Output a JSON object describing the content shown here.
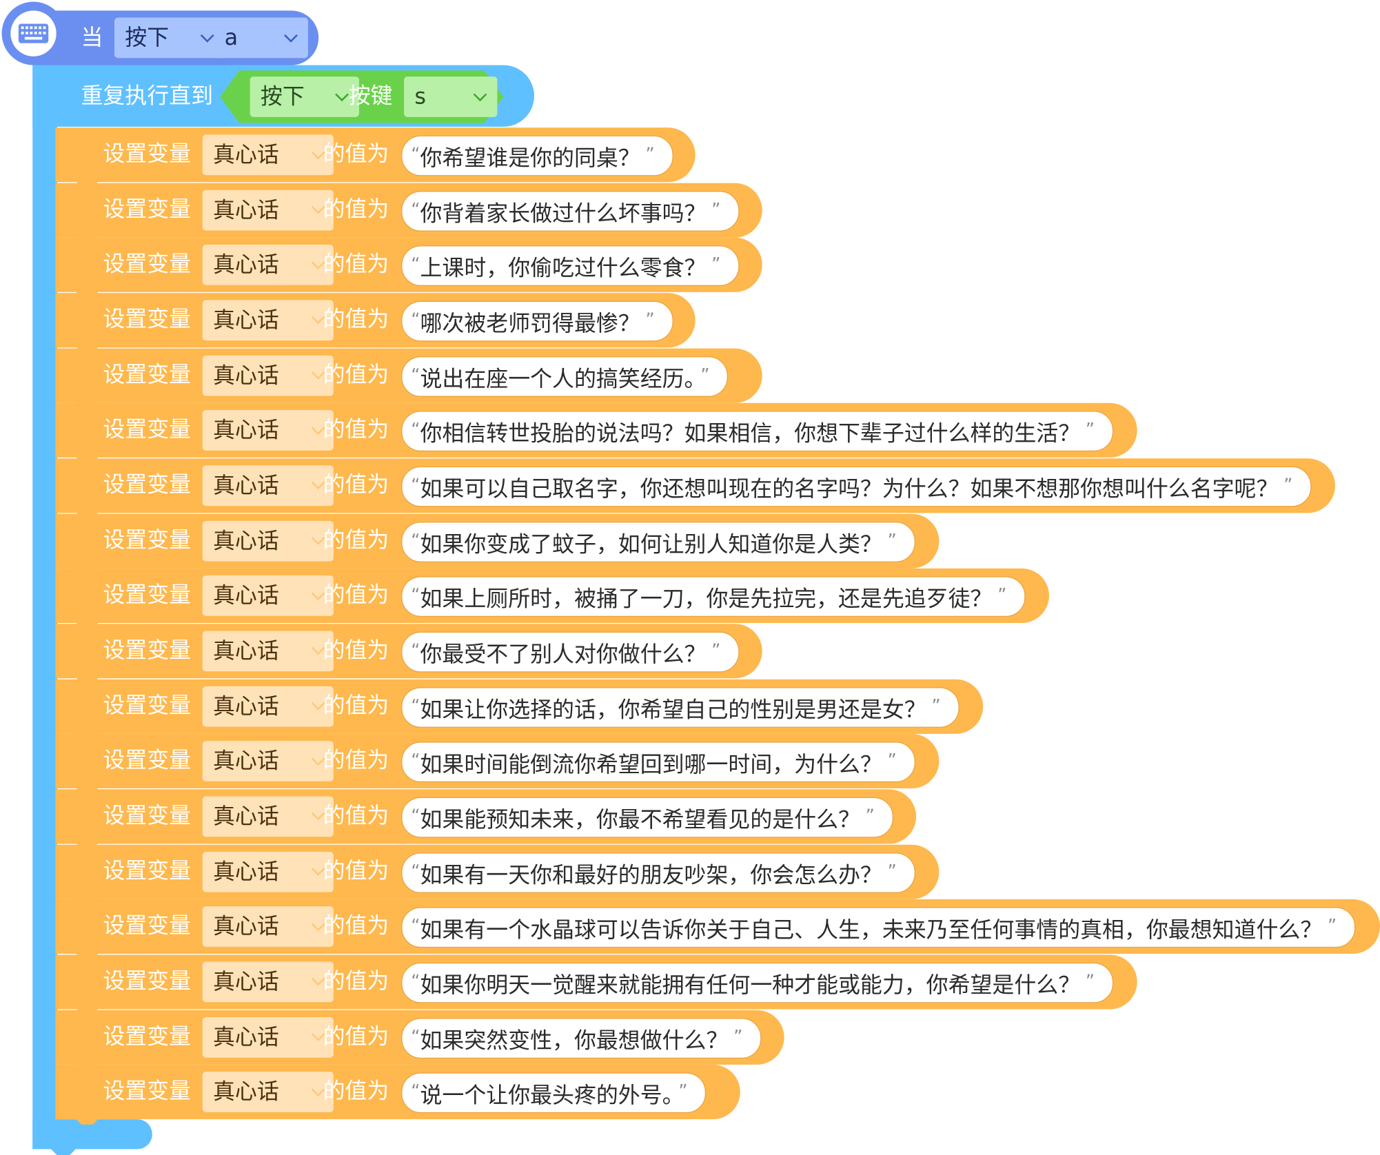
{
  "event_block": {
    "icon": "keyboard-icon",
    "when_label": "当",
    "action_dropdown": "按下",
    "key_dropdown": "a"
  },
  "loop_block": {
    "label": "重复执行直到",
    "condition": {
      "action_dropdown": "按下",
      "key_label": "按键",
      "key_dropdown": "s"
    }
  },
  "set_blocks": {
    "set_label": "设置变量",
    "variable": "真心话",
    "value_label": "的值为",
    "values": [
      "你希望谁是你的同桌？",
      "你背着家长做过什么坏事吗？",
      "上课时，你偷吃过什么零食？",
      "哪次被老师罚得最惨？",
      "说出在座一个人的搞笑经历。",
      "你相信转世投胎的说法吗？如果相信，你想下辈子过什么样的生活？",
      "如果可以自己取名字，你还想叫现在的名字吗？为什么？如果不想那你想叫什么名字呢？",
      "如果你变成了蚊子，如何让别人知道你是人类？",
      "如果上厕所时，被捅了一刀，你是先拉完，还是先追歹徒？",
      "你最受不了别人对你做什么？",
      "如果让你选择的话，你希望自己的性别是男还是女？",
      "如果时间能倒流你希望回到哪一时间，为什么？",
      "如果能预知未来，你最不希望看见的是什么？",
      "如果有一天你和最好的朋友吵架，你会怎么办？",
      "如果有一个水晶球可以告诉你关于自己、人生，未来乃至任何事情的真相，你最想知道什么？",
      "如果你明天一觉醒来就能拥有任何一种才能或能力，你希望是什么？",
      "如果突然变性，你最想做什么？",
      "说一个让你最头疼的外号。"
    ],
    "quote_open": "“",
    "quote_close": "”"
  },
  "colors": {
    "event": "#6a8ff0",
    "control": "#5fc0ff",
    "sensing": "#6ad24a",
    "variables": "#ffb84d"
  }
}
